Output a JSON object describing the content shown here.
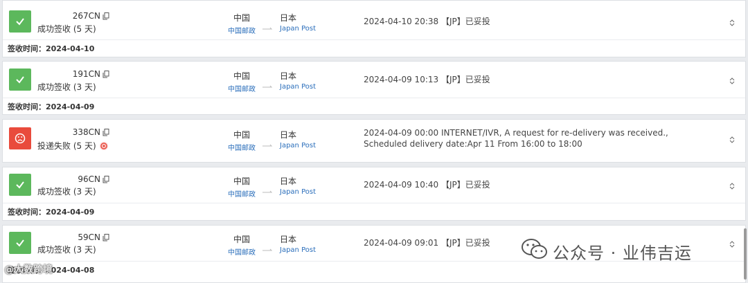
{
  "shipments": [
    {
      "status": "success",
      "tracking": "267CN",
      "status_text": "成功签收 (5 天)",
      "origin": {
        "country": "中国",
        "carrier": "中国邮政"
      },
      "dest": {
        "country": "日本",
        "carrier": "Japan Post"
      },
      "event": "2024-04-10 20:38 【JP】已妥投",
      "footer": "签收时间：2024-04-10"
    },
    {
      "status": "success",
      "tracking": "191CN",
      "status_text": "成功签收 (3 天)",
      "origin": {
        "country": "中国",
        "carrier": "中国邮政"
      },
      "dest": {
        "country": "日本",
        "carrier": "Japan Post"
      },
      "event": "2024-04-09 10:13 【JP】已妥投",
      "footer": "签收时间：2024-04-09"
    },
    {
      "status": "fail",
      "tracking": "338CN",
      "status_text": "投递失败 (5 天)",
      "origin": {
        "country": "中国",
        "carrier": "中国邮政"
      },
      "dest": {
        "country": "日本",
        "carrier": "Japan Post"
      },
      "event": "2024-04-09 00:00 INTERNET/IVR, A request for re-delivery was received., Scheduled delivery date:Apr 11 From 16:00 to 18:00",
      "footer": ""
    },
    {
      "status": "success",
      "tracking": "96CN",
      "status_text": "成功签收 (3 天)",
      "origin": {
        "country": "中国",
        "carrier": "中国邮政"
      },
      "dest": {
        "country": "日本",
        "carrier": "Japan Post"
      },
      "event": "2024-04-09 10:40 【JP】已妥投",
      "footer": "签收时间：2024-04-09"
    },
    {
      "status": "success",
      "tracking": "59CN",
      "status_text": "成功签收 (3 天)",
      "origin": {
        "country": "中国",
        "carrier": "中国邮政"
      },
      "dest": {
        "country": "日本",
        "carrier": "Japan Post"
      },
      "event": "2024-04-09 09:01 【JP】已妥投",
      "footer": "签收时间：2024-04-08"
    }
  ],
  "watermark": "公众号 · 业伟吉运",
  "watermark2": "@大数跨境",
  "colors": {
    "success": "#5cb85c",
    "fail": "#e94b3c",
    "carrier_link": "#2a6ebb"
  }
}
